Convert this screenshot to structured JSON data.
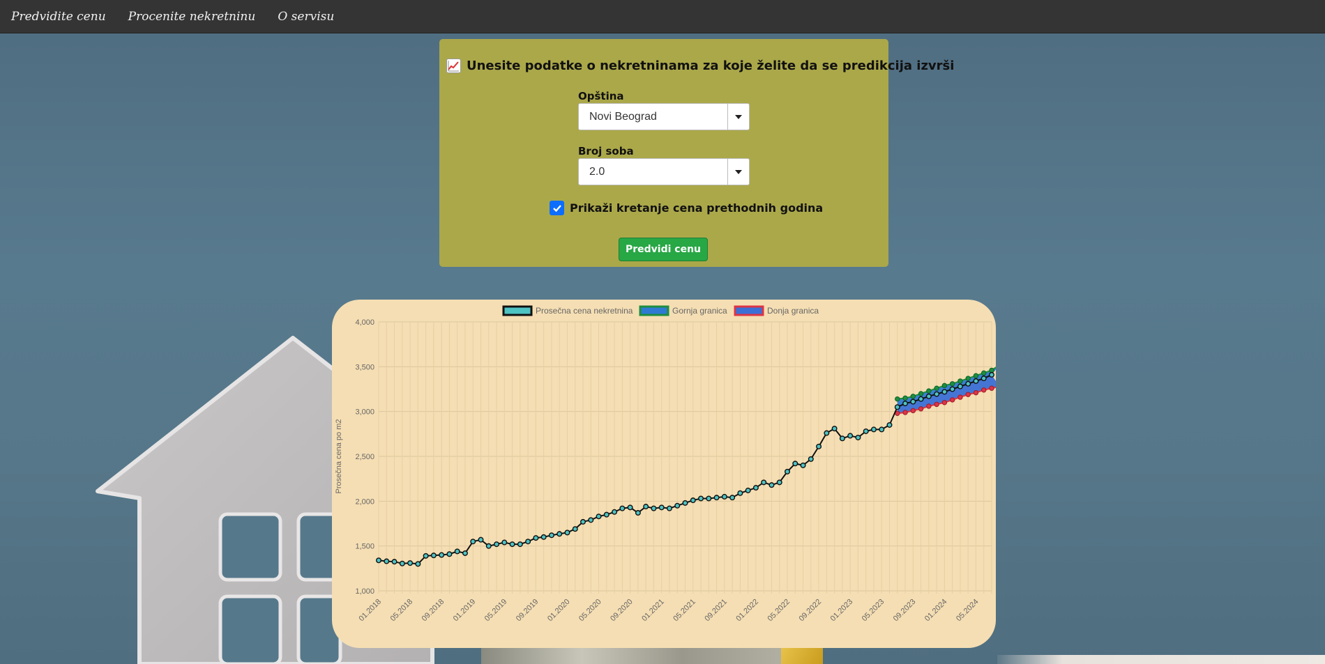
{
  "nav": {
    "items": [
      "Predvidite cenu",
      "Procenite nekretninu",
      "O servisu"
    ]
  },
  "form": {
    "title": "Unesite podatke o nekretninama za koje želite da se predikcija izvrši",
    "title_icon": "chart-increasing-icon",
    "municipality_label": "Opština",
    "municipality_value": "Novi Beograd",
    "rooms_label": "Broj soba",
    "rooms_value": "2.0",
    "history_checkbox_label": "Prikaži kretanje cena prethodnih godina",
    "history_checkbox_checked": true,
    "predict_button": "Predvidi cenu"
  },
  "colors": {
    "form_panel": "#aba84a",
    "chart_panel": "#f5deb3",
    "avg_fill": "#4ec3c3",
    "upper_fill": "#2e7ad3",
    "upper_border": "#1e8e3e",
    "lower_fill": "#3b6fd6",
    "lower_border": "#dc3545",
    "button": "#28a745"
  },
  "chart_data": {
    "type": "line",
    "ylabel": "Prosečna cena po m2",
    "ylim": [
      1000,
      4000
    ],
    "yticks": [
      "1,000",
      "1,500",
      "2,000",
      "2,500",
      "3,000",
      "3,500",
      "4,000"
    ],
    "grid": true,
    "legend_position": "top",
    "x_tick_labels": [
      "01.2018",
      "05.2018",
      "09.2018",
      "01.2019",
      "05.2019",
      "09.2019",
      "01.2020",
      "05.2020",
      "09.2020",
      "01.2021",
      "05.2021",
      "09.2021",
      "01.2022",
      "05.2022",
      "09.2022",
      "01.2023",
      "05.2023",
      "09.2023",
      "01.2024",
      "05.2024"
    ],
    "x_start": "01.2018",
    "x_end": "06.2024",
    "series": [
      {
        "name": "Prosečna cena nekretnina",
        "values": [
          1340,
          1330,
          1325,
          1305,
          1310,
          1300,
          1390,
          1395,
          1400,
          1410,
          1440,
          1420,
          1550,
          1570,
          1500,
          1520,
          1540,
          1520,
          1520,
          1550,
          1590,
          1600,
          1620,
          1635,
          1650,
          1690,
          1770,
          1790,
          1830,
          1850,
          1880,
          1920,
          1930,
          1870,
          1940,
          1920,
          1930,
          1920,
          1950,
          1980,
          2010,
          2030,
          2030,
          2040,
          2050,
          2040,
          2090,
          2120,
          2150,
          2210,
          2180,
          2210,
          2330,
          2420,
          2400,
          2470,
          2610,
          2760,
          2810,
          2700,
          2730,
          2710,
          2780,
          2800,
          2800,
          2850,
          3050,
          3090,
          3110,
          3140,
          3170,
          3195,
          3220,
          3250,
          3280,
          3310,
          3340,
          3370,
          3410
        ]
      },
      {
        "name": "Gornja granica",
        "start_index": 66,
        "values": [
          3140,
          3150,
          3170,
          3200,
          3230,
          3260,
          3290,
          3310,
          3340,
          3370,
          3400,
          3430,
          3460,
          3520
        ]
      },
      {
        "name": "Donja granica",
        "start_index": 66,
        "values": [
          2980,
          2990,
          3010,
          3030,
          3060,
          3080,
          3100,
          3130,
          3160,
          3190,
          3210,
          3240,
          3260,
          3280
        ]
      }
    ]
  }
}
